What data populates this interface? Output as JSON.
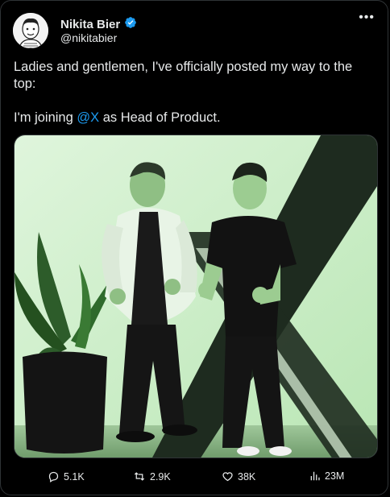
{
  "author": {
    "name": "Nikita Bier",
    "handle": "@nikitabier",
    "verified": true,
    "verified_color": "#1d9bf0"
  },
  "menu_icon": "more-horizontal-icon",
  "post": {
    "line1": "Ladies and gentlemen, I've officially posted my way to the top:",
    "line2_prefix": "I'm joining ",
    "line2_mention": "@X",
    "line2_suffix": " as Head of Product."
  },
  "image": {
    "description_icon": "photo-two-men-thumbs-up"
  },
  "stats": {
    "replies": "5.1K",
    "reposts": "2.9K",
    "likes": "38K",
    "views": "23M"
  },
  "colors": {
    "background": "#000000",
    "text": "#e7e9ea",
    "accent": "#1d9bf0",
    "border": "#2f3336"
  }
}
